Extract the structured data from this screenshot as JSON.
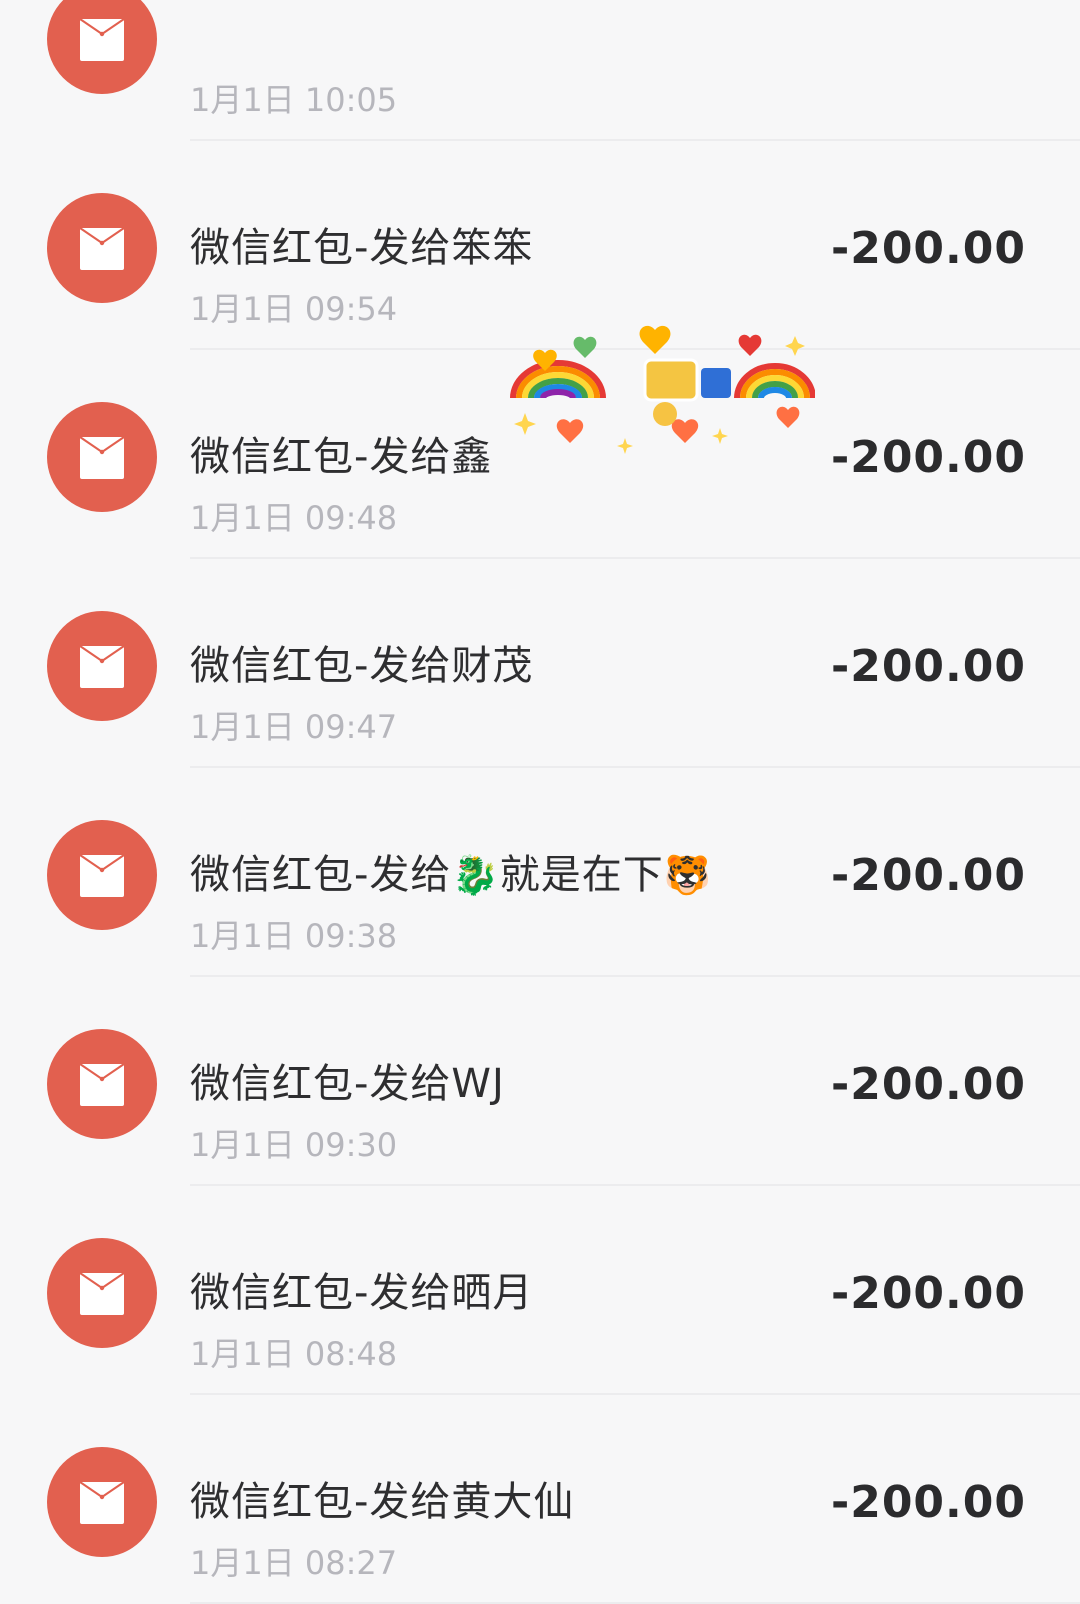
{
  "colors": {
    "icon_bg": "#e2604f",
    "background": "#f7f7f8",
    "title": "#2e2e30",
    "time": "#b6b6bc",
    "amount": "#2b2b2d"
  },
  "transactions": [
    {
      "title": "",
      "time": "1月1日 10:05",
      "amount": ""
    },
    {
      "title": "微信红包-发给笨笨",
      "time": "1月1日 09:54",
      "amount": "-200.00"
    },
    {
      "title": "微信红包-发给鑫",
      "time": "1月1日 09:48",
      "amount": "-200.00"
    },
    {
      "title": "微信红包-发给财茂",
      "time": "1月1日 09:47",
      "amount": "-200.00"
    },
    {
      "title_prefix": "微信红包-发给",
      "title_mid": "就是在下",
      "emoji_1": "🐉",
      "emoji_2": "🐯",
      "time": "1月1日 09:38",
      "amount": "-200.00"
    },
    {
      "title": "微信红包-发给WJ",
      "time": "1月1日 09:30",
      "amount": "-200.00"
    },
    {
      "title": "微信红包-发给晒月",
      "time": "1月1日 08:48",
      "amount": "-200.00"
    },
    {
      "title": "微信红包-发给黄大仙",
      "time": "1月1日 08:27",
      "amount": "-200.00"
    }
  ],
  "icon_name": "red-envelope-icon",
  "sticker_name": "rainbow-hearts-sticker"
}
